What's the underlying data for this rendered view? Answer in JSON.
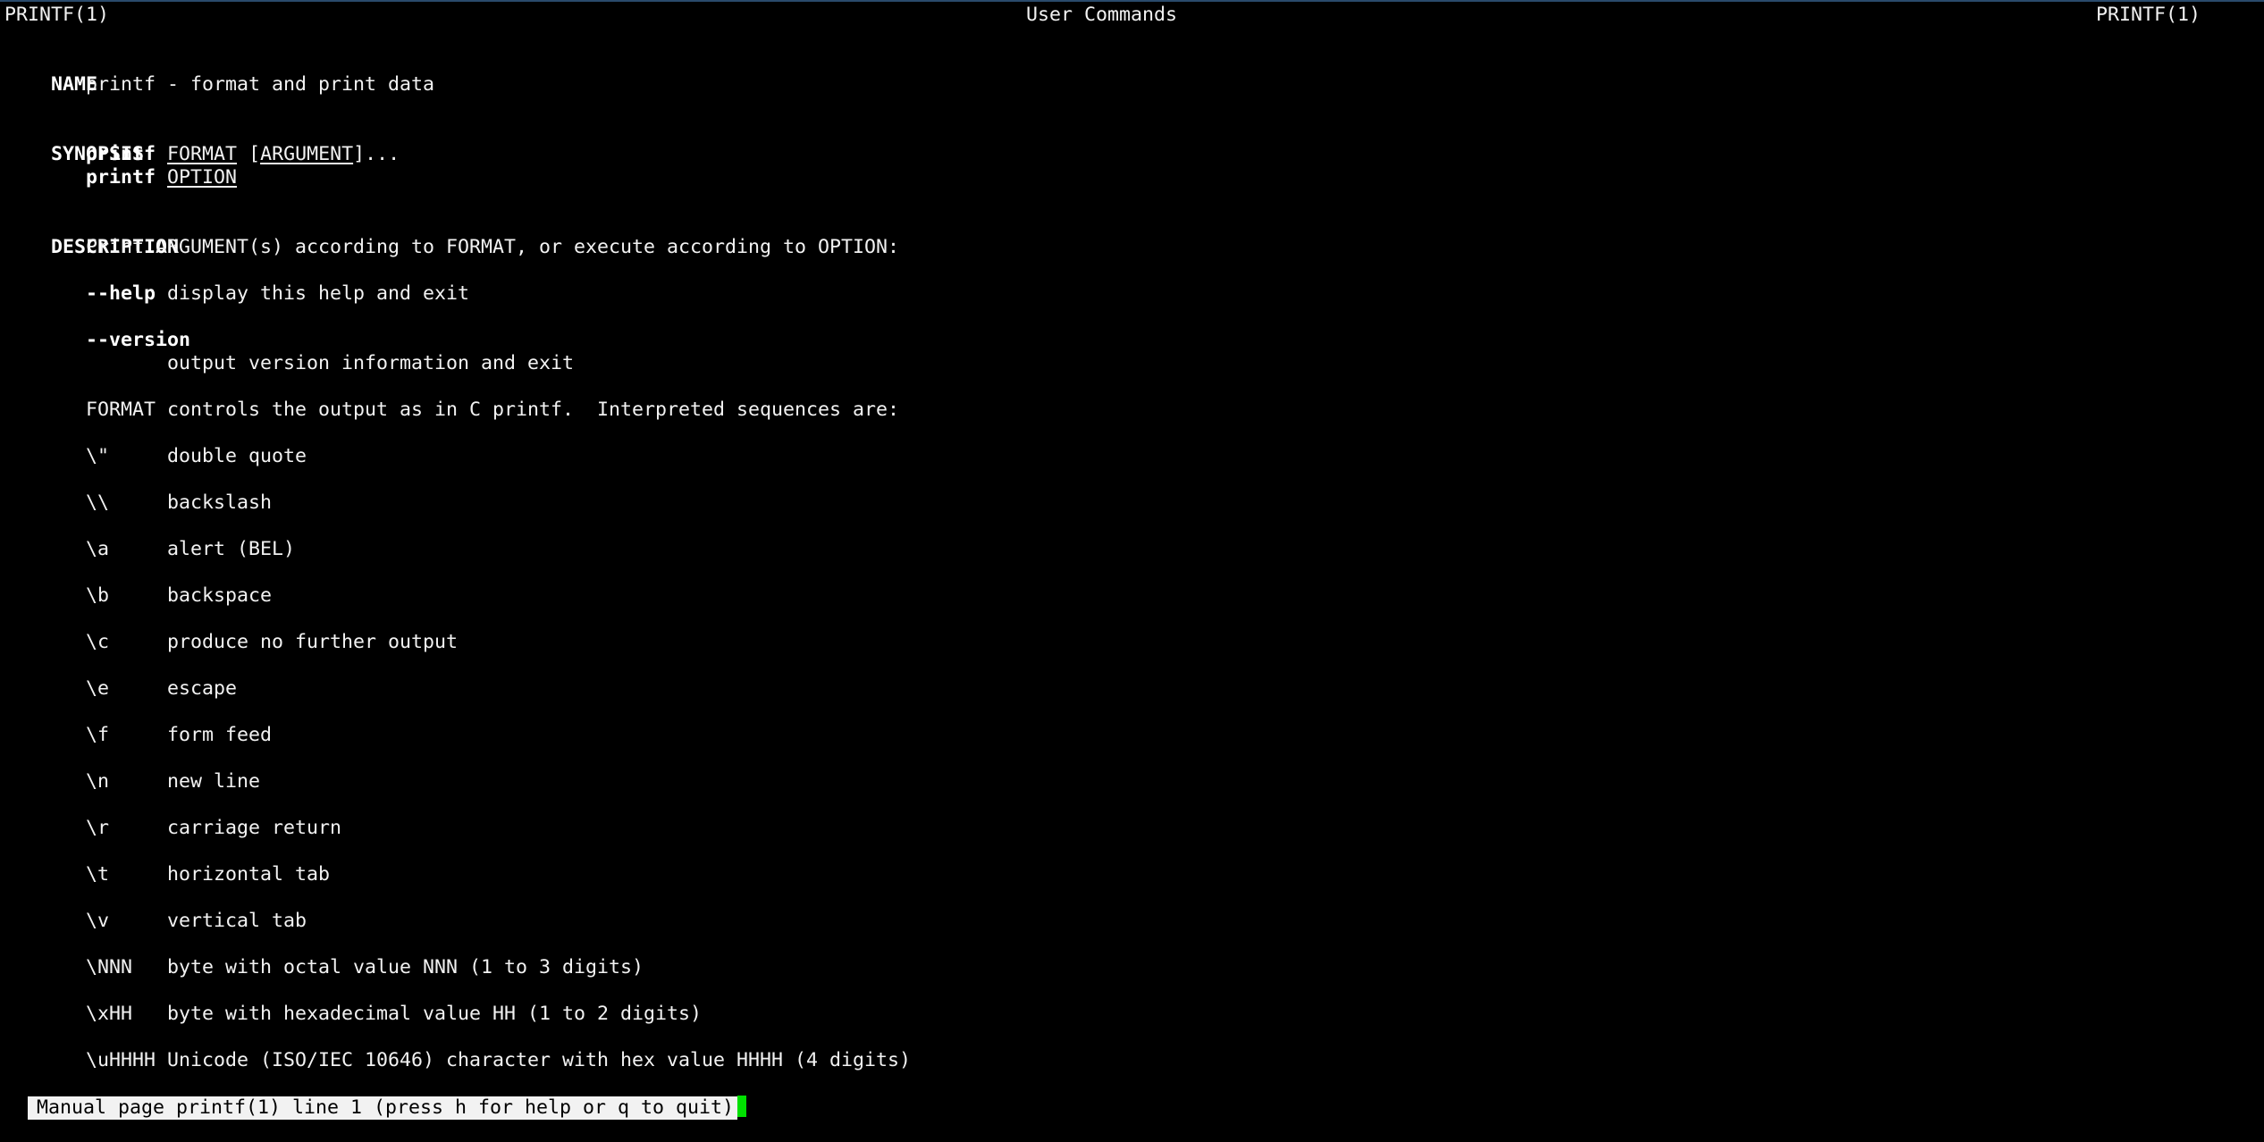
{
  "header": {
    "left": "PRINTF(1)",
    "center": "User Commands",
    "right": "PRINTF(1)"
  },
  "name_section": {
    "heading": "NAME",
    "text": "printf - format and print data"
  },
  "synopsis": {
    "heading": "SYNOPSIS",
    "line1": {
      "cmd": "printf",
      "arg1": "FORMAT",
      "open_bracket": "[",
      "arg2": "ARGUMENT",
      "close": "]..."
    },
    "line2": {
      "cmd": "printf",
      "arg": "OPTION"
    }
  },
  "description": {
    "heading": "DESCRIPTION",
    "intro": "Print ARGUMENT(s) according to FORMAT, or execute according to OPTION:",
    "help_option": "--help",
    "help_text": " display this help and exit",
    "version_option": "--version",
    "version_text": "output version information and exit",
    "format_text": "FORMAT controls the output as in C printf.  Interpreted sequences are:",
    "sequences": [
      {
        "seq": "\\\"",
        "desc": "double quote"
      },
      {
        "seq": "\\\\",
        "desc": "backslash"
      },
      {
        "seq": "\\a",
        "desc": "alert (BEL)"
      },
      {
        "seq": "\\b",
        "desc": "backspace"
      },
      {
        "seq": "\\c",
        "desc": "produce no further output"
      },
      {
        "seq": "\\e",
        "desc": "escape"
      },
      {
        "seq": "\\f",
        "desc": "form feed"
      },
      {
        "seq": "\\n",
        "desc": "new line"
      },
      {
        "seq": "\\r",
        "desc": "carriage return"
      },
      {
        "seq": "\\t",
        "desc": "horizontal tab"
      },
      {
        "seq": "\\v",
        "desc": "vertical tab"
      },
      {
        "seq": "\\NNN",
        "desc": "byte with octal value NNN (1 to 3 digits)"
      },
      {
        "seq": "\\xHH",
        "desc": "byte with hexadecimal value HH (1 to 2 digits)"
      },
      {
        "seq": "\\uHHHH",
        "desc": "Unicode (ISO/IEC 10646) character with hex value HHHH (4 digits)"
      }
    ]
  },
  "status_bar": {
    "text": "Manual page printf(1) line 1 (press h for help or q to quit)",
    "cursor_color": "#00e000"
  }
}
